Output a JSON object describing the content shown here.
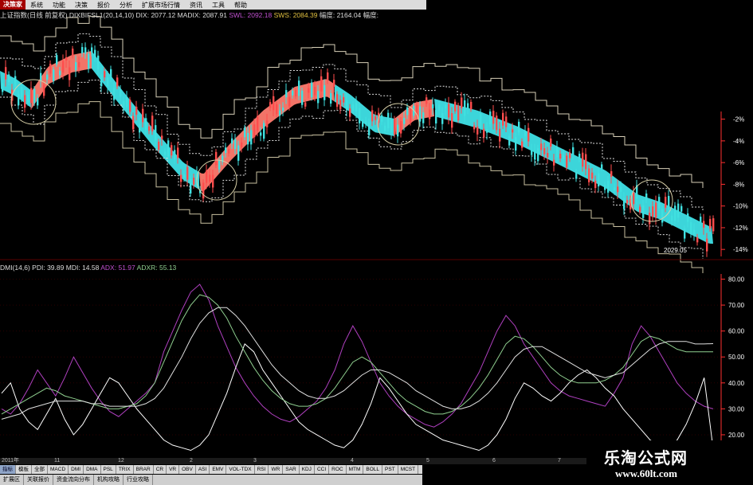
{
  "menubar": {
    "logo": "决策家",
    "items": [
      "系统",
      "功能",
      "决策",
      "报价",
      "分析",
      "扩展市场行情",
      "资讯",
      "工具",
      "帮助"
    ]
  },
  "infobar": {
    "title": "上证指数(日线 前复权)",
    "indicator": "DIXBIFSL1(20,14,10)",
    "dix_label": "DIX:",
    "dix_value": "2077.12",
    "madix_label": "MADIX:",
    "madix_value": "2087.91",
    "swl_label": "SWL:",
    "swl_value": "2092.18",
    "sws_label": "SWS:",
    "sws_value": "2084.39",
    "fuz_label": "幅度:",
    "fuz_value": "2164.04",
    "fuz2_label": "幅度:"
  },
  "dmibar": {
    "name": "DMI(14,6)",
    "pdi_label": "PDI:",
    "pdi_value": "39.89",
    "mdi_label": "MDI:",
    "mdi_value": "14.58",
    "adx_label": "ADX:",
    "adx_value": "51.97",
    "adxr_label": "ADXR:",
    "adxr_value": "55.13"
  },
  "price_label": "2029.05",
  "colors": {
    "bull": "#ff4d4d",
    "bear": "#40e0e0",
    "band_up": "#ff7a6e",
    "band_down": "#3fe0e6",
    "pdi": "#b040c0",
    "mdi": "#ffffff",
    "adx": "#90d090",
    "adxr": "#e0e0e0",
    "axis_red": "#ff3030"
  },
  "chart_data": [
    {
      "type": "candlestick",
      "title": "上证指数(日线 前复权)",
      "y_axis_ticks": [
        "-2%",
        "-4%",
        "-6%",
        "-8%",
        "-10%",
        "-12%",
        "-14%"
      ],
      "ylim": [
        -14.5,
        -1
      ],
      "x_ticks": [
        "2011年",
        "11",
        "12",
        "2",
        "3",
        "4",
        "5",
        "6",
        "7"
      ],
      "series": [
        {
          "name": "DIX",
          "value": 2077.12
        },
        {
          "name": "MADIX",
          "value": 2087.91
        },
        {
          "name": "SWL",
          "value": 2092.18
        },
        {
          "name": "SWS",
          "value": 2084.39
        }
      ],
      "trend_band_segments": [
        {
          "direction": "down",
          "x_range": [
            0,
            40
          ]
        },
        {
          "direction": "up",
          "x_range": [
            40,
            115
          ]
        },
        {
          "direction": "down",
          "x_range": [
            115,
            250
          ]
        },
        {
          "direction": "up",
          "x_range": [
            250,
            420
          ]
        },
        {
          "direction": "down",
          "x_range": [
            420,
            495
          ]
        },
        {
          "direction": "up",
          "x_range": [
            495,
            545
          ]
        },
        {
          "direction": "down",
          "x_range": [
            545,
            895
          ]
        }
      ],
      "last_close": 2029.05
    },
    {
      "type": "line",
      "title": "DMI(14,6)",
      "y_axis_ticks": [
        "80.00",
        "70.00",
        "60.00",
        "50.00",
        "40.00",
        "30.00",
        "20.00"
      ],
      "ylim": [
        12,
        82
      ],
      "series": [
        {
          "name": "PDI",
          "values": [
            30,
            28,
            32,
            38,
            45,
            40,
            35,
            42,
            50,
            44,
            38,
            33,
            29,
            27,
            30,
            33,
            36,
            40,
            52,
            60,
            68,
            75,
            78,
            72,
            62,
            54,
            46,
            40,
            35,
            31,
            28,
            26,
            25,
            27,
            30,
            33,
            38,
            45,
            55,
            62,
            56,
            48,
            40,
            35,
            31,
            28,
            26,
            24,
            23,
            25,
            28,
            32,
            38,
            44,
            52,
            60,
            66,
            62,
            55,
            50,
            45,
            40,
            37,
            35,
            34,
            33,
            32,
            31,
            36,
            42,
            55,
            62,
            58,
            52,
            46,
            40,
            36,
            33,
            31,
            30
          ],
          "last": 39.89
        },
        {
          "name": "MDI",
          "values": [
            36,
            40,
            30,
            25,
            22,
            28,
            34,
            26,
            20,
            24,
            30,
            36,
            42,
            40,
            35,
            30,
            26,
            22,
            18,
            16,
            15,
            14,
            16,
            20,
            28,
            36,
            46,
            55,
            52,
            45,
            40,
            35,
            30,
            25,
            22,
            20,
            18,
            16,
            15,
            18,
            24,
            32,
            42,
            38,
            33,
            28,
            24,
            22,
            20,
            18,
            17,
            16,
            15,
            14,
            16,
            20,
            26,
            34,
            40,
            38,
            35,
            33,
            36,
            40,
            43,
            45,
            42,
            38,
            35,
            30,
            26,
            22,
            18,
            16,
            15,
            18,
            24,
            32,
            42,
            14.58
          ],
          "last": 14.58
        },
        {
          "name": "ADX",
          "values": [
            28,
            30,
            32,
            34,
            36,
            38,
            37,
            35,
            34,
            33,
            32,
            31,
            30,
            30,
            31,
            32,
            35,
            40,
            48,
            56,
            64,
            70,
            74,
            73,
            70,
            65,
            58,
            52,
            46,
            41,
            37,
            34,
            32,
            31,
            31,
            32,
            34,
            38,
            43,
            48,
            50,
            48,
            44,
            40,
            36,
            33,
            31,
            29,
            28,
            28,
            29,
            31,
            34,
            38,
            43,
            49,
            55,
            58,
            57,
            54,
            50,
            46,
            43,
            41,
            40,
            40,
            40,
            41,
            43,
            46,
            51,
            56,
            58,
            57,
            55,
            53,
            52,
            52,
            52,
            51.97
          ],
          "last": 51.97
        },
        {
          "name": "ADXR",
          "values": [
            26,
            27,
            28,
            30,
            31,
            32,
            33,
            33,
            33,
            33,
            32,
            32,
            31,
            31,
            31,
            31,
            32,
            34,
            38,
            44,
            50,
            57,
            63,
            67,
            69,
            69,
            66,
            62,
            57,
            52,
            47,
            43,
            40,
            37,
            35,
            34,
            34,
            35,
            37,
            40,
            43,
            45,
            45,
            44,
            42,
            40,
            37,
            35,
            33,
            31,
            30,
            30,
            31,
            33,
            36,
            40,
            45,
            50,
            53,
            54,
            54,
            52,
            50,
            48,
            46,
            44,
            43,
            42,
            43,
            44,
            47,
            50,
            53,
            55,
            56,
            56,
            56,
            55,
            55,
            55.13
          ],
          "last": 55.13
        }
      ]
    }
  ],
  "datestrip": [
    "2011年",
    "11",
    "12",
    "2",
    "3",
    "4",
    "5",
    "6",
    "7"
  ],
  "tabs": [
    "指标",
    "模板",
    "全部",
    "MACD",
    "DMI",
    "DMA",
    "PSL",
    "TRIX",
    "BRAR",
    "CR",
    "VR",
    "OBV",
    "ASI",
    "EMV",
    "VOL-TDX",
    "RSI",
    "WR",
    "SAR",
    "KDJ",
    "CCI",
    "ROC",
    "MTM",
    "BOLL",
    "PST",
    "MCST"
  ],
  "subtabs": [
    "扩展区",
    "关联报价",
    "资金流向分布",
    "机构攻略",
    "行业攻略"
  ],
  "watermark": {
    "title": "乐淘公式网",
    "url": "www.60lt.com"
  }
}
